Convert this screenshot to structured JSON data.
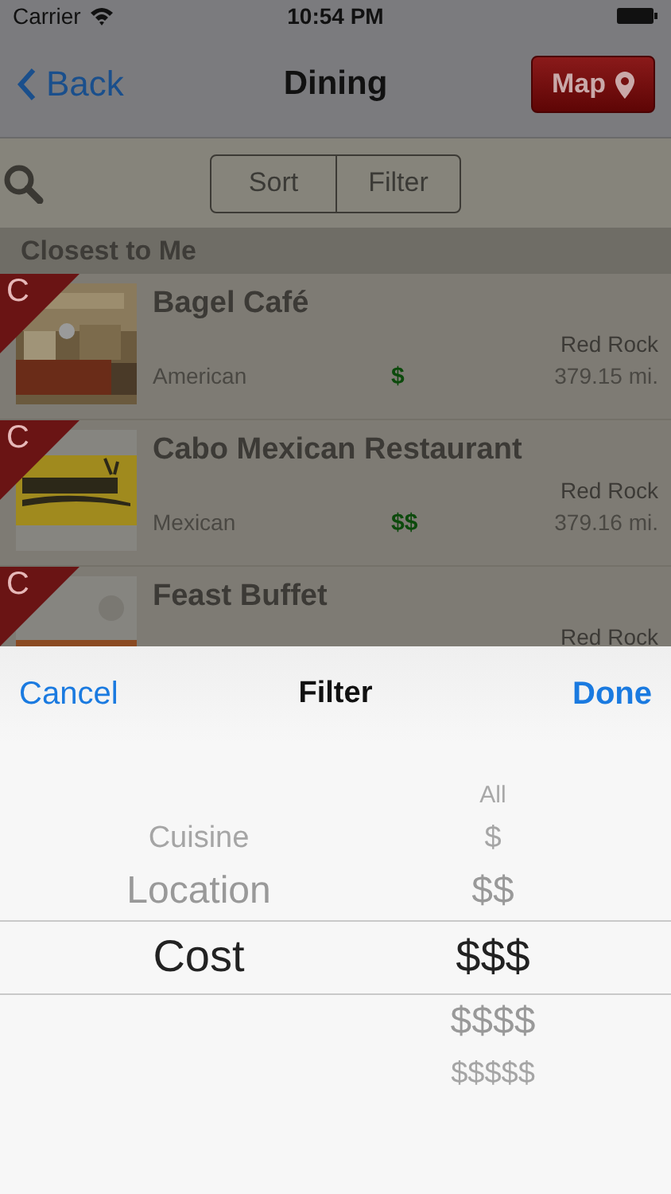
{
  "status_bar": {
    "carrier": "Carrier",
    "time": "10:54 PM"
  },
  "nav": {
    "back": "Back",
    "title": "Dining",
    "map": "Map"
  },
  "toolbar": {
    "segments": [
      {
        "label": "Sort",
        "selected": false
      },
      {
        "label": "Filter",
        "selected": false
      }
    ]
  },
  "section": "Closest to Me",
  "restaurants": [
    {
      "badge": "C",
      "name": "Bagel Café",
      "location": "Red Rock",
      "cuisine": "American",
      "price": "$",
      "distance": "379.15 mi."
    },
    {
      "badge": "C",
      "name": "Cabo Mexican Restaurant",
      "location": "Red Rock",
      "cuisine": "Mexican",
      "price": "$$",
      "distance": "379.16 mi."
    },
    {
      "badge": "C",
      "name": "Feast Buffet",
      "location": "Red Rock"
    }
  ],
  "sheet": {
    "cancel": "Cancel",
    "title": "Filter",
    "done": "Done",
    "columns": [
      {
        "items": [
          {
            "label": "Cuisine",
            "selected": false
          },
          {
            "label": "Location",
            "selected": false
          },
          {
            "label": "Cost",
            "selected": true
          }
        ]
      },
      {
        "items": [
          {
            "label": "All",
            "selected": false
          },
          {
            "label": "$",
            "selected": false
          },
          {
            "label": "$$",
            "selected": false
          },
          {
            "label": "$$$",
            "selected": true
          },
          {
            "label": "$$$$",
            "selected": false
          },
          {
            "label": "$$$$$",
            "selected": false
          }
        ]
      }
    ]
  }
}
